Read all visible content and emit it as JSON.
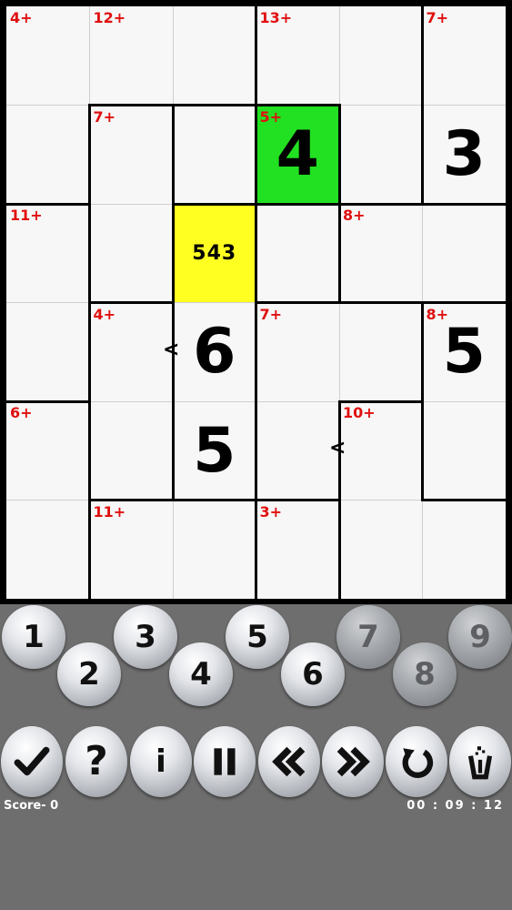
{
  "puzzle": {
    "size": 6,
    "cells": [
      {
        "r": 0,
        "c": 0,
        "clue": "4+"
      },
      {
        "r": 0,
        "c": 1,
        "clue": "12+"
      },
      {
        "r": 0,
        "c": 3,
        "clue": "13+"
      },
      {
        "r": 0,
        "c": 5,
        "clue": "7+"
      },
      {
        "r": 1,
        "c": 1,
        "clue": "7+"
      },
      {
        "r": 1,
        "c": 3,
        "clue": "5+",
        "value": "4",
        "highlight": "#22e022"
      },
      {
        "r": 1,
        "c": 5,
        "value": "3"
      },
      {
        "r": 2,
        "c": 0,
        "clue": "11+"
      },
      {
        "r": 2,
        "c": 2,
        "candidates": "543",
        "highlight": "#ffff22"
      },
      {
        "r": 2,
        "c": 4,
        "clue": "8+"
      },
      {
        "r": 3,
        "c": 1,
        "clue": "4+"
      },
      {
        "r": 3,
        "c": 2,
        "value": "6"
      },
      {
        "r": 3,
        "c": 3,
        "clue": "7+"
      },
      {
        "r": 3,
        "c": 5,
        "clue": "8+",
        "value": "5"
      },
      {
        "r": 4,
        "c": 0,
        "clue": "6+"
      },
      {
        "r": 4,
        "c": 2,
        "value": "5"
      },
      {
        "r": 4,
        "c": 4,
        "clue": "10+"
      },
      {
        "r": 5,
        "c": 1,
        "clue": "11+"
      },
      {
        "r": 5,
        "c": 3,
        "clue": "3+"
      }
    ],
    "inequalities": [
      {
        "r": 3,
        "c": 2,
        "side": "left",
        "symbol": "<"
      },
      {
        "r": 4,
        "c": 4,
        "side": "left",
        "symbol": "<"
      }
    ],
    "cages": [
      [
        0,
        0,
        0,
        1,
        1,
        2
      ],
      [
        0,
        3,
        1,
        4,
        1,
        2
      ],
      [
        5,
        3,
        6,
        1,
        7,
        7
      ],
      [
        5,
        8,
        6,
        9,
        9,
        10
      ],
      [
        11,
        8,
        6,
        9,
        12,
        10
      ],
      [
        11,
        13,
        13,
        14,
        12,
        12
      ]
    ]
  },
  "number_pad": [
    {
      "label": "1",
      "enabled": true
    },
    {
      "label": "2",
      "enabled": true
    },
    {
      "label": "3",
      "enabled": true
    },
    {
      "label": "4",
      "enabled": true
    },
    {
      "label": "5",
      "enabled": true
    },
    {
      "label": "6",
      "enabled": true
    },
    {
      "label": "7",
      "enabled": false
    },
    {
      "label": "8",
      "enabled": false
    },
    {
      "label": "9",
      "enabled": false
    }
  ],
  "toolbar": {
    "info_label": "i"
  },
  "status": {
    "score_text": "Score- 0",
    "timer_text": "00 : 09 : 12"
  }
}
